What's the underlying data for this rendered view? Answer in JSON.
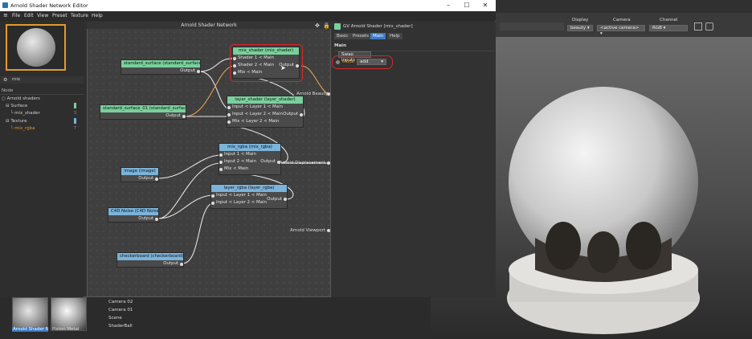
{
  "window": {
    "title": "Arnold Shader Network Editor"
  },
  "menu": [
    "File",
    "Edit",
    "View",
    "Preset",
    "Texture",
    "Help"
  ],
  "search": {
    "value": "mix"
  },
  "tree": {
    "header": "Node",
    "items": [
      {
        "label": "Arnold shaders",
        "level": 0
      },
      {
        "label": "Surface",
        "level": 1
      },
      {
        "label": "mix_shader",
        "level": 2,
        "tag": "S"
      },
      {
        "label": "Texture",
        "level": 1
      },
      {
        "label": "mix_rgba",
        "level": 2,
        "tag": "T",
        "highlight": true
      }
    ]
  },
  "canvas": {
    "title": "Arnold Shader Network"
  },
  "nodes": {
    "standard_surface": {
      "title": "standard_surface (standard_surface)",
      "out": "Output"
    },
    "standard_surface_01": {
      "title": "standard_surface_01 (standard_surface)",
      "out": "Output"
    },
    "mix_shader": {
      "title": "mix_shader (mix_shader)",
      "in1": "Shader 1 < Main",
      "in2": "Shader 2 < Main",
      "in3": "Mix < Main",
      "out": "Output"
    },
    "layer_shader": {
      "title": "layer_shader (layer_shader)",
      "in1": "Input < Layer 1 < Main",
      "in2": "Input < Layer 2 < Main",
      "in3": "Mix < Layer 2 < Main",
      "out": "Output"
    },
    "mix_rgba": {
      "title": "mix_rgba (mix_rgba)",
      "in1": "Input 1 < Main",
      "in2": "Input 2 < Main",
      "in3": "Mix < Main",
      "out": "Output"
    },
    "image": {
      "title": "image (image)",
      "out": "Output"
    },
    "layer_rgba": {
      "title": "layer_rgba (layer_rgba)",
      "in1": "Input < Layer 1 < Main",
      "in2": "Input < Layer 2 < Main",
      "out": "Output"
    },
    "c4d_noise": {
      "title": "C4D Noise (C4D Noise)",
      "out": "Output"
    },
    "checkerboard": {
      "title": "checkerboard (checkerboard)",
      "out": "Output"
    }
  },
  "outputs": {
    "beauty": "Arnold Beauty",
    "displacement": "Arnold Displacement",
    "viewport": "Arnold Viewport"
  },
  "attributes": {
    "header": "GV Arnold Shader [mix_shader]",
    "tabs": [
      "Basic",
      "Presets",
      "Main",
      "Help"
    ],
    "active_tab": "Main",
    "section": "Main",
    "swap_button": "Swap inputs",
    "mode_label": "Mode",
    "mode_value": "add"
  },
  "render_view": {
    "display_label": "Display",
    "display_value": "beauty",
    "camera_label": "Camera",
    "camera_value": "<active camera>",
    "channel_label": "Channel",
    "channel_value": "RGB"
  },
  "objects": [
    "Camera 02",
    "Camera 01",
    "Scene",
    "ShaderBall"
  ],
  "materials": [
    "Arnold Shader Ne",
    "Piston Metal"
  ],
  "colors": {
    "accent": "#3d7bc7",
    "highlight_red": "#d62828",
    "preview_border": "#e49a2c"
  }
}
